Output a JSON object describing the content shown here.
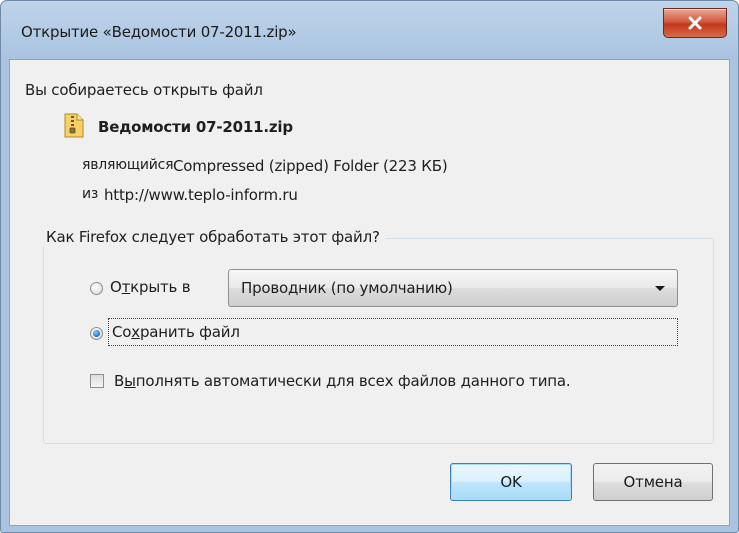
{
  "window": {
    "title": "Открытие «Ведомости 07-2011.zip»"
  },
  "prompt": "Вы собираетесь открыть файл",
  "file": {
    "name": "Ведомости 07-2011.zip",
    "type_label": "являющийся",
    "type_value": "Compressed (zipped) Folder (223 КБ)",
    "source_label": "из",
    "source_value": "http://www.teplo-inform.ru"
  },
  "action_group": {
    "legend": "Как Firefox следует обработать этот файл?",
    "open_with": {
      "label_pre": "О",
      "label_accel": "т",
      "label_post": "крыть в",
      "checked": false
    },
    "app_select": {
      "selected": "Проводник (по умолчанию)"
    },
    "save_file": {
      "label_pre": "Со",
      "label_accel": "х",
      "label_post": "ранить файл",
      "checked": true
    },
    "auto_checkbox": {
      "label_pre": "В",
      "label_accel": "ы",
      "label_post": "полнять автоматически для всех файлов данного типа.",
      "checked": false
    }
  },
  "buttons": {
    "ok": "OK",
    "cancel": "Отмена"
  },
  "icons": {
    "file": "zip-folder-icon",
    "close": "close-icon",
    "dropdown": "chevron-down-icon"
  },
  "colors": {
    "title_bar": "#a9c3e0",
    "close_button": "#c23a1e",
    "client_bg": "#f0f0f0",
    "default_button": "#bee6fd",
    "radio_dot": "#1f6fc9"
  }
}
